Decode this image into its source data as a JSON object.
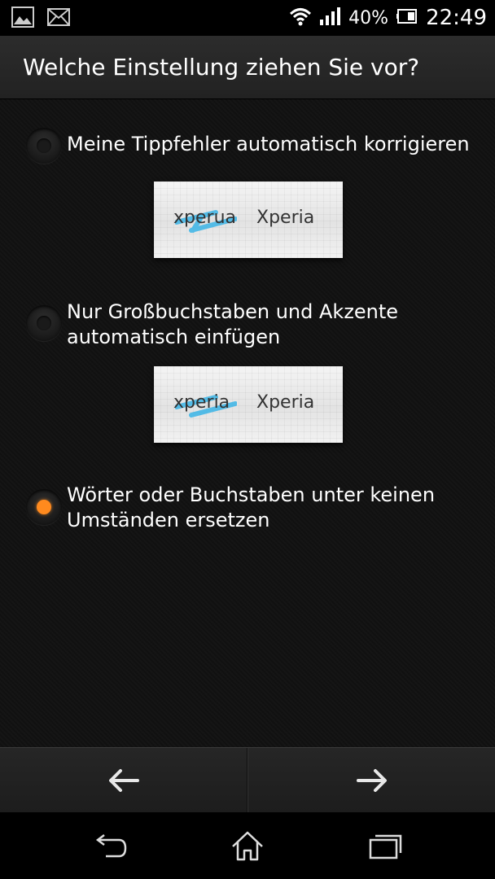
{
  "status_bar": {
    "left_icons": [
      "gallery-icon",
      "email-icon"
    ],
    "battery_percent": "40%",
    "time": "22:49",
    "right_icons": [
      "wifi-icon",
      "signal-icon",
      "battery-icon"
    ]
  },
  "title": "Welche Einstellung ziehen Sie vor?",
  "options": [
    {
      "label_line1": "Meine Tippfehler automatisch korrigieren",
      "label_line2": "",
      "selected": false,
      "sample": {
        "wrong": "xperua",
        "right": "Xperia"
      }
    },
    {
      "label_line1": "Nur Großbuchstaben und Akzente",
      "label_line2": "automatisch einfügen",
      "selected": false,
      "sample": {
        "wrong": "xperia",
        "right": "Xperia"
      }
    },
    {
      "label_line1": "Wörter oder Buchstaben unter keinen",
      "label_line2": "Umständen ersetzen",
      "selected": true
    }
  ],
  "wizard": {
    "back_icon": "arrow-left-icon",
    "next_icon": "arrow-right-icon"
  },
  "system_nav": {
    "icons": [
      "back-icon",
      "home-icon",
      "recent-apps-icon"
    ]
  },
  "colors": {
    "accent": "#ff8a1e",
    "background": "#111111"
  }
}
